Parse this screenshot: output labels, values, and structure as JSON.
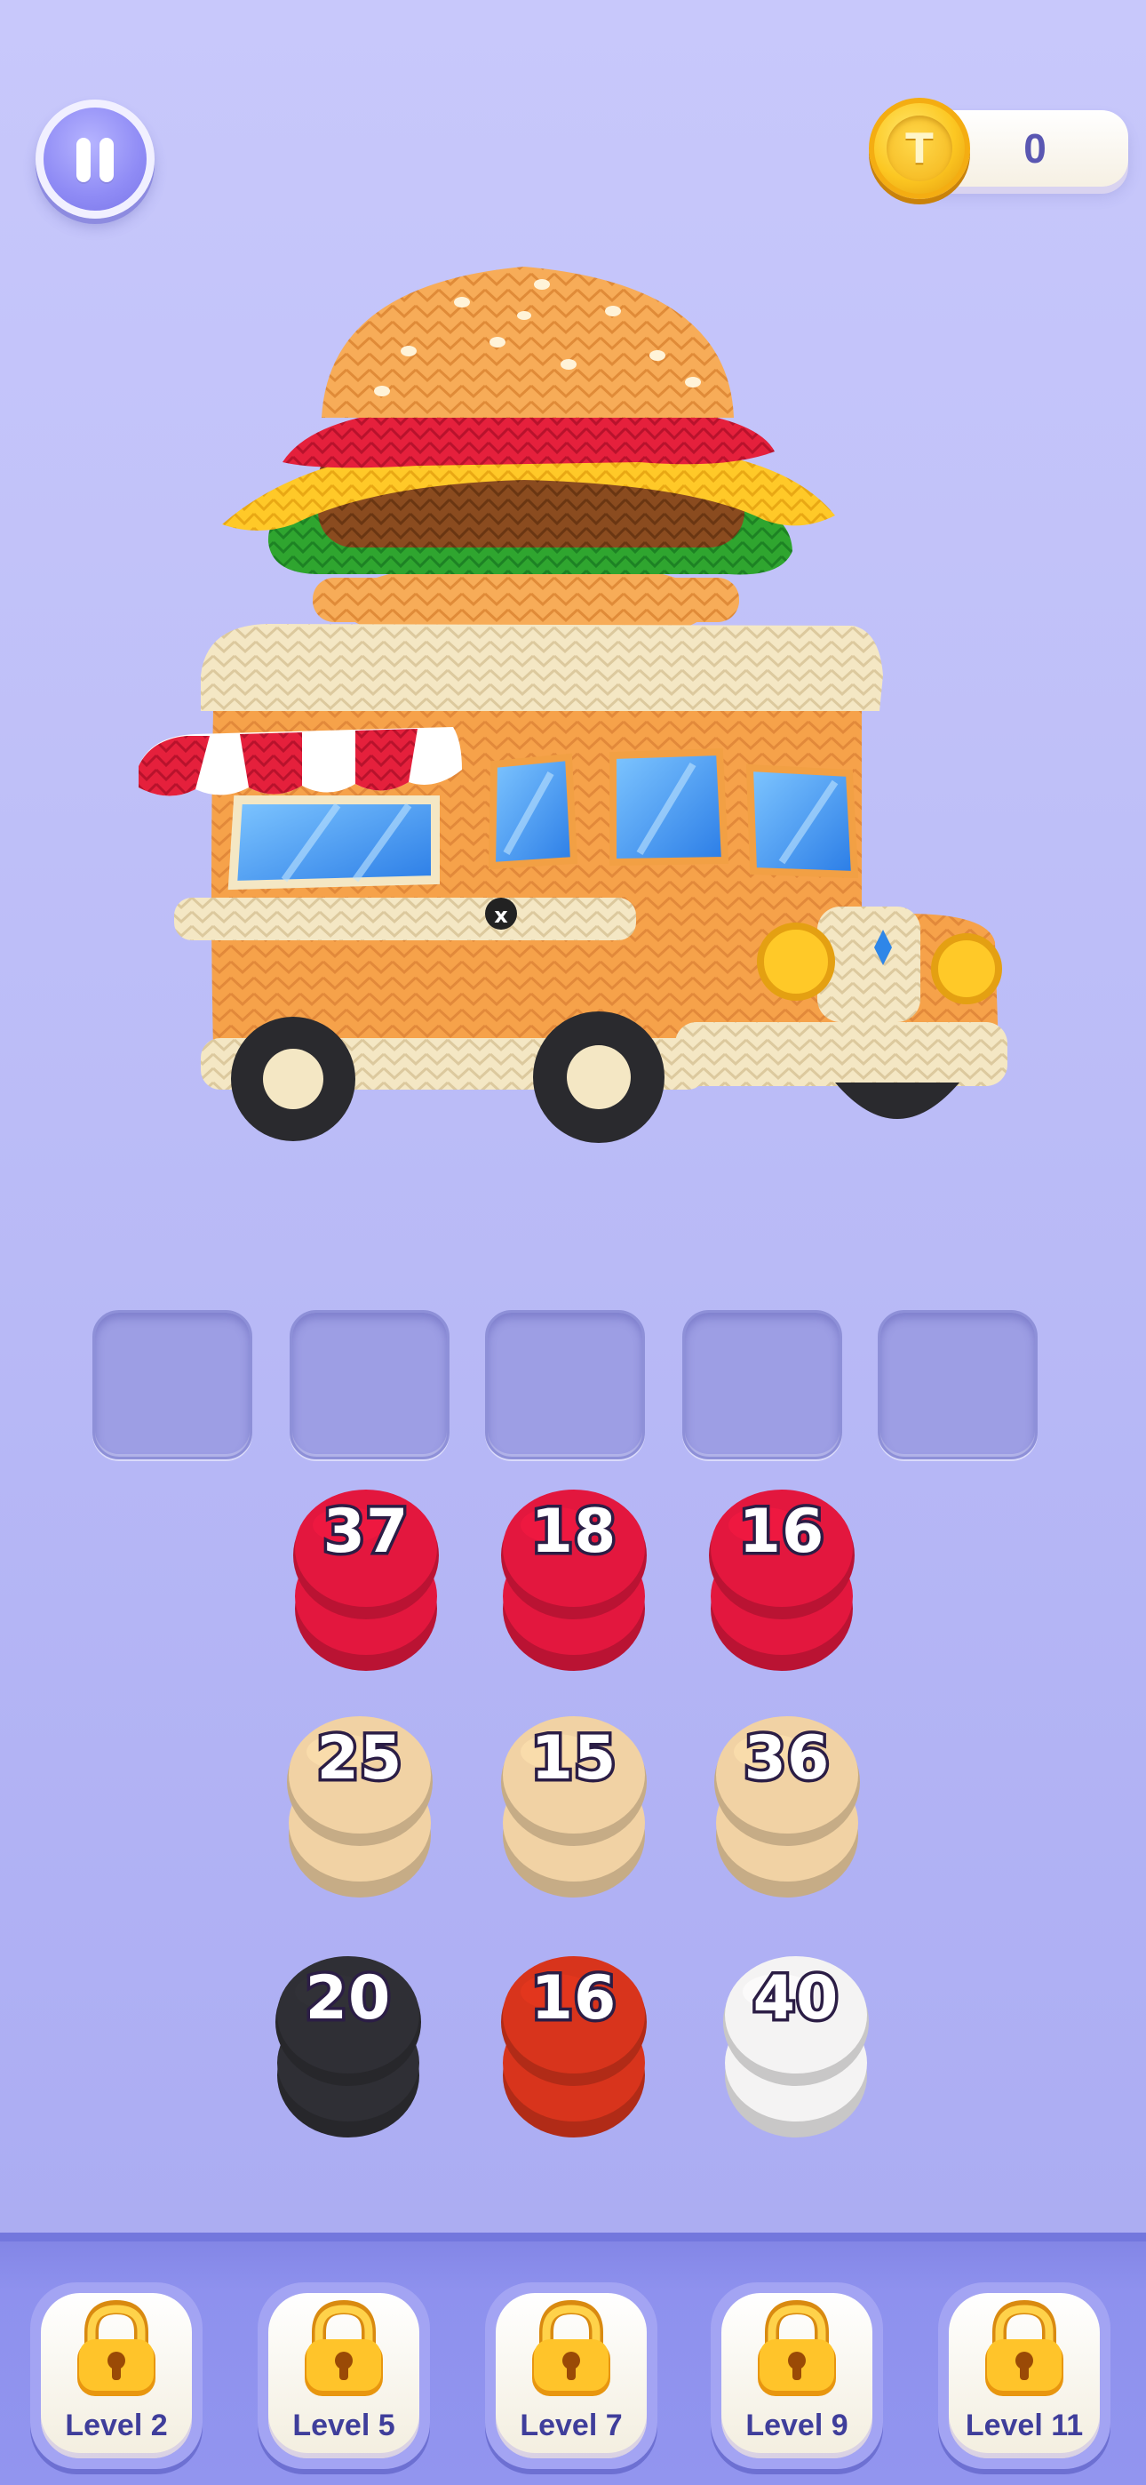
{
  "hud": {
    "coins": "0",
    "pause_icon": "pause-icon",
    "coin_icon": "coin-icon",
    "coin_glyph": "T"
  },
  "target": {
    "description_icon": "burger-food-truck",
    "truck_badge": "x"
  },
  "slots": {
    "count": 5
  },
  "stacks": [
    {
      "label": "37",
      "color": "#e3173e"
    },
    {
      "label": "18",
      "color": "#e3173e"
    },
    {
      "label": "16",
      "color": "#e3173e"
    },
    {
      "label": "25",
      "color": "#f1d2a4"
    },
    {
      "label": "15",
      "color": "#f1d2a4"
    },
    {
      "label": "36",
      "color": "#f1d2a4"
    },
    {
      "label": "20",
      "color": "#2f2f35"
    },
    {
      "label": "16",
      "color": "#d8341c"
    },
    {
      "label": "40",
      "color": "#f4f3f3"
    }
  ],
  "levels": [
    {
      "label": "Level 2",
      "locked": true
    },
    {
      "label": "Level 5",
      "locked": true
    },
    {
      "label": "Level 7",
      "locked": true
    },
    {
      "label": "Level 9",
      "locked": true
    },
    {
      "label": "Level 11",
      "locked": true
    }
  ]
}
